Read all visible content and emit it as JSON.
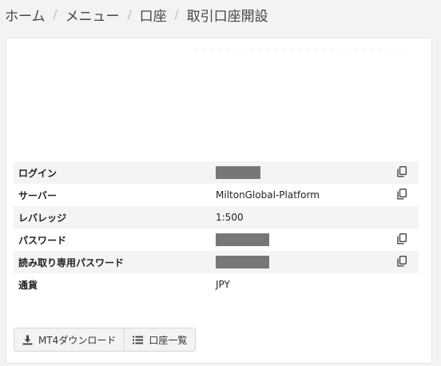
{
  "breadcrumb": {
    "items": [
      "ホーム",
      "メニュー",
      "口座",
      "取引口座開設"
    ],
    "separator": "/"
  },
  "account": {
    "rows": [
      {
        "label": "ログイン",
        "value": "",
        "masked": true,
        "copyable": true
      },
      {
        "label": "サーバー",
        "value": "MiltonGlobal-Platform",
        "masked": false,
        "copyable": true
      },
      {
        "label": "レバレッジ",
        "value": "1:500",
        "masked": false,
        "copyable": false
      },
      {
        "label": "パスワード",
        "value": "",
        "masked": true,
        "copyable": true
      },
      {
        "label": "読み取り専用パスワード",
        "value": "",
        "masked": true,
        "copyable": true
      },
      {
        "label": "通貨",
        "value": "JPY",
        "masked": false,
        "copyable": false
      }
    ]
  },
  "buttons": {
    "download_label": "MT4ダウンロード",
    "account_list_label": "口座一覧"
  },
  "icons": {
    "copy": "copy-icon",
    "download": "download-icon",
    "list": "list-icon"
  },
  "colors": {
    "mask": "#777777",
    "row_stripe": "#f4f4f4"
  }
}
